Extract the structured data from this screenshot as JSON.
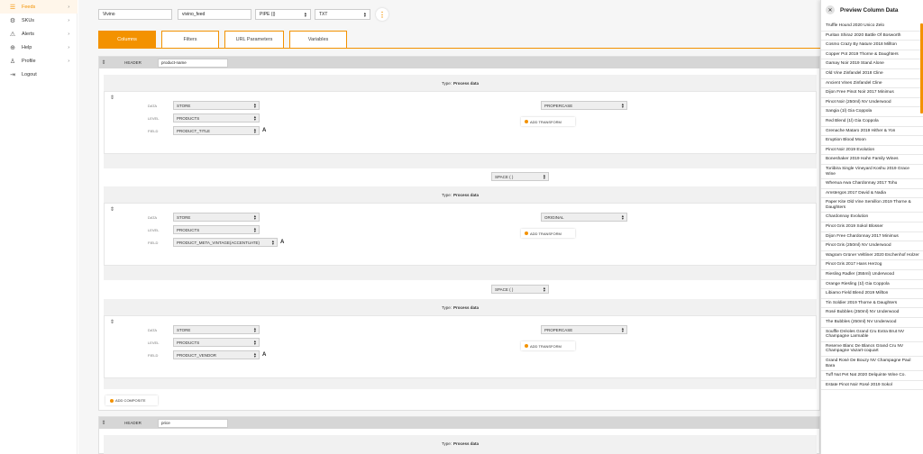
{
  "sidebar": {
    "items": [
      {
        "label": "Feeds",
        "icon": "feeds-icon",
        "glyph": "☰"
      },
      {
        "label": "SKUs",
        "icon": "skus-icon",
        "glyph": "⚙"
      },
      {
        "label": "Alerts",
        "icon": "alert-icon",
        "glyph": "⚠"
      },
      {
        "label": "Help",
        "icon": "help-icon",
        "glyph": "⊕"
      },
      {
        "label": "Profile",
        "icon": "profile-icon",
        "glyph": "♙"
      },
      {
        "label": "Logout",
        "icon": "logout-icon",
        "glyph": "⇥"
      }
    ],
    "chevron": "›"
  },
  "topbar": {
    "name_value": "Vivino",
    "feed_value": "vivino_feed",
    "delimiter": "PIPE (|)",
    "format": "TXT",
    "kebab": "⋮"
  },
  "tabs": [
    "Columns",
    "Filters",
    "URL Parameters",
    "Variables"
  ],
  "columns": [
    {
      "header_label": "HEADER",
      "header_value": "product-name",
      "sections": [
        {
          "type_label": "Type:",
          "type_value": "Process data",
          "data_label": "DATA",
          "data_value": "STORE",
          "level_label": "LEVEL",
          "level_value": "PRODUCTS",
          "field_label": "FIELD",
          "field_value": "PRODUCT_TITLE",
          "transform": "PROPERCASE",
          "add_transform": "ADD TRANSFORM"
        },
        {
          "type_label": "Type:",
          "type_value": "Process data",
          "data_label": "DATA",
          "data_value": "STORE",
          "level_label": "LEVEL",
          "level_value": "PRODUCTS",
          "field_label": "FIELD",
          "field_value": "PRODUCT_META_VINTAGE(ACCENTUATE)",
          "transform": "ORIGINAL",
          "add_transform": "ADD TRANSFORM"
        },
        {
          "type_label": "Type:",
          "type_value": "Process data",
          "data_label": "DATA",
          "data_value": "STORE",
          "level_label": "LEVEL",
          "level_value": "PRODUCTS",
          "field_label": "FIELD",
          "field_value": "PRODUCT_VENDOR",
          "transform": "PROPERCASE",
          "add_transform": "ADD TRANSFORM"
        }
      ],
      "separators": [
        "SPACE ( )",
        "SPACE ( )"
      ],
      "add_composite": "ADD COMPOSITE"
    },
    {
      "header_label": "HEADER",
      "header_value": "price",
      "type_label": "Type:",
      "type_value": "Process data"
    }
  ],
  "preview": {
    "title": "Preview Column Data",
    "close": "✕",
    "items": [
      "Truffle Hound 2020 Unico Zelo",
      "Puritan Shiraz 2020 Battle Of Bosworth",
      "Cosmo Crazy By Nature 2018 Millton",
      "Copper Pot 2019 Thorne & Daughters",
      "Gamay Noir 2019 Stand Alone",
      "Old Vine Zinfandel 2018 Cline",
      "Ancient Vines Zinfandel Cline",
      "Dijon Free Pinot Noir 2017 Minimus",
      "Pinot Noir (250ml) NV Underwood",
      "Sangia (1l) Gia Coppola",
      "Red Blend (1l) Gia Coppola",
      "Grenache Mataro 2019 Hither & Yon",
      "Eruption Blood Moon",
      "Pinot Noir 2019 Evolution",
      "Boneshaker 2019 Hahn Family Wines",
      "Toriibira Single Vineyard Koshu 2019 Grace Wine",
      "Whenua Awa Chardonnay 2017 Tohu",
      "Amstergos 2017 David & Nadia",
      "Paper Kite Old Vine Semillon 2019 Thorne & Daughters",
      "Chardonnay Evolution",
      "Pinot Gris 2019 Sokol Blosser",
      "Dijon Free Chardonnay 2017 Minimus",
      "Pinot Gris (250ml) NV Underwood",
      "Wagram Grüner Veltliner 2020 Eschenhof Holzer",
      "Pinot Gris 2017 Hans Herzog",
      "Riesling Radler (355ml) Underwood",
      "Orange Riesling (1l) Gia Coppola",
      "Libiamo Field Blend 2019 Millton",
      "Tin Soldier 2019 Thorne & Daughters",
      "Rosé Bubbles (250ml) NV Underwood",
      "The Bubbles (250ml) NV Underwood",
      "Souffle Dréoles Grand Cru Extra Brut NV Champagne Larmable",
      "Reserve Blanc De Blancs Grand Cru NV Champagne Vazart-coquart",
      "Grand Rosé De Bouzy NV Champagne Paul Bara",
      "Tuff Nut Pet Nat 2020 Delquinte Wine Co.",
      "Estate Pinot Noir Rosé 2019 Sokol"
    ]
  },
  "colors": {
    "accent": "#f39200",
    "header_bg": "#d6d6d6"
  }
}
